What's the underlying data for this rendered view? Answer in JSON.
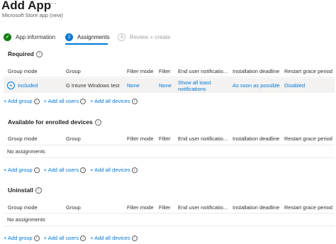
{
  "header": {
    "title": "Add App",
    "more_label": "···",
    "subtitle": "Microsoft Store app (new)"
  },
  "wizard": {
    "steps": [
      {
        "number": "✓",
        "label": "App information",
        "state": "completed"
      },
      {
        "number": "2",
        "label": "Assignments",
        "state": "active"
      },
      {
        "number": "3",
        "label": "Review + create",
        "state": "disabled"
      }
    ]
  },
  "columns": [
    "Group mode",
    "Group",
    "Filter mode",
    "Filter",
    "End user notificatio...",
    "Installation deadline",
    "Restart grace period"
  ],
  "sections": [
    {
      "title": "Required",
      "rows": [
        {
          "group_mode": "Included",
          "group": "G Intune Windows test",
          "filter_mode": "None",
          "filter": "None",
          "end_user_notification_line1": "Show all toast",
          "end_user_notification_line2": "notifications",
          "installation_deadline": "As soon as possible",
          "restart_grace_period": "Disabled"
        }
      ],
      "actions": [
        "+ Add group",
        "+ Add all users",
        "+ Add all devices"
      ]
    },
    {
      "title": "Available for enrolled devices",
      "empty_text": "No assignments",
      "actions": [
        "+ Add group",
        "+ Add all users",
        "+ Add all devices"
      ]
    },
    {
      "title": "Uninstall",
      "empty_text": "No assignments",
      "actions": [
        "+ Add group",
        "+ Add all users",
        "+ Add all devices"
      ]
    }
  ],
  "colors": {
    "accent": "#0078d4",
    "success": "#107c10",
    "row_highlight": "#f3f2f1"
  }
}
